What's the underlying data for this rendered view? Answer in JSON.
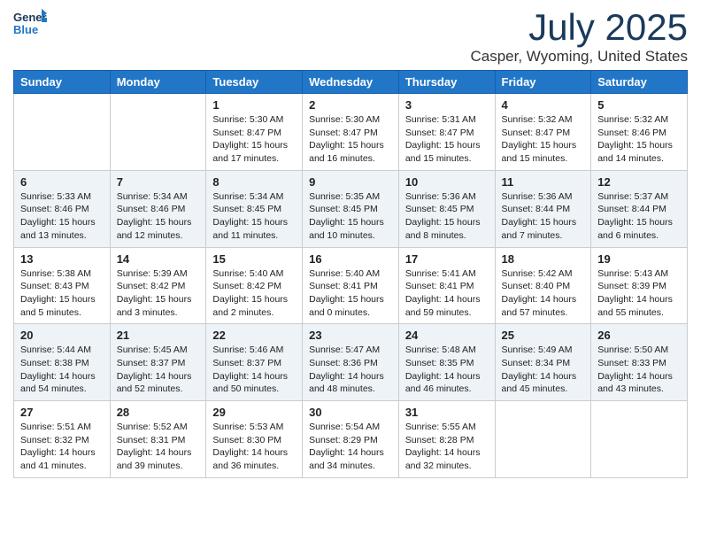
{
  "header": {
    "logo_line1": "General",
    "logo_line2": "Blue",
    "main_title": "July 2025",
    "subtitle": "Casper, Wyoming, United States"
  },
  "calendar": {
    "days_of_week": [
      "Sunday",
      "Monday",
      "Tuesday",
      "Wednesday",
      "Thursday",
      "Friday",
      "Saturday"
    ],
    "weeks": [
      [
        {
          "day": "",
          "info": ""
        },
        {
          "day": "",
          "info": ""
        },
        {
          "day": "1",
          "info": "Sunrise: 5:30 AM\nSunset: 8:47 PM\nDaylight: 15 hours\nand 17 minutes."
        },
        {
          "day": "2",
          "info": "Sunrise: 5:30 AM\nSunset: 8:47 PM\nDaylight: 15 hours\nand 16 minutes."
        },
        {
          "day": "3",
          "info": "Sunrise: 5:31 AM\nSunset: 8:47 PM\nDaylight: 15 hours\nand 15 minutes."
        },
        {
          "day": "4",
          "info": "Sunrise: 5:32 AM\nSunset: 8:47 PM\nDaylight: 15 hours\nand 15 minutes."
        },
        {
          "day": "5",
          "info": "Sunrise: 5:32 AM\nSunset: 8:46 PM\nDaylight: 15 hours\nand 14 minutes."
        }
      ],
      [
        {
          "day": "6",
          "info": "Sunrise: 5:33 AM\nSunset: 8:46 PM\nDaylight: 15 hours\nand 13 minutes."
        },
        {
          "day": "7",
          "info": "Sunrise: 5:34 AM\nSunset: 8:46 PM\nDaylight: 15 hours\nand 12 minutes."
        },
        {
          "day": "8",
          "info": "Sunrise: 5:34 AM\nSunset: 8:45 PM\nDaylight: 15 hours\nand 11 minutes."
        },
        {
          "day": "9",
          "info": "Sunrise: 5:35 AM\nSunset: 8:45 PM\nDaylight: 15 hours\nand 10 minutes."
        },
        {
          "day": "10",
          "info": "Sunrise: 5:36 AM\nSunset: 8:45 PM\nDaylight: 15 hours\nand 8 minutes."
        },
        {
          "day": "11",
          "info": "Sunrise: 5:36 AM\nSunset: 8:44 PM\nDaylight: 15 hours\nand 7 minutes."
        },
        {
          "day": "12",
          "info": "Sunrise: 5:37 AM\nSunset: 8:44 PM\nDaylight: 15 hours\nand 6 minutes."
        }
      ],
      [
        {
          "day": "13",
          "info": "Sunrise: 5:38 AM\nSunset: 8:43 PM\nDaylight: 15 hours\nand 5 minutes."
        },
        {
          "day": "14",
          "info": "Sunrise: 5:39 AM\nSunset: 8:42 PM\nDaylight: 15 hours\nand 3 minutes."
        },
        {
          "day": "15",
          "info": "Sunrise: 5:40 AM\nSunset: 8:42 PM\nDaylight: 15 hours\nand 2 minutes."
        },
        {
          "day": "16",
          "info": "Sunrise: 5:40 AM\nSunset: 8:41 PM\nDaylight: 15 hours\nand 0 minutes."
        },
        {
          "day": "17",
          "info": "Sunrise: 5:41 AM\nSunset: 8:41 PM\nDaylight: 14 hours\nand 59 minutes."
        },
        {
          "day": "18",
          "info": "Sunrise: 5:42 AM\nSunset: 8:40 PM\nDaylight: 14 hours\nand 57 minutes."
        },
        {
          "day": "19",
          "info": "Sunrise: 5:43 AM\nSunset: 8:39 PM\nDaylight: 14 hours\nand 55 minutes."
        }
      ],
      [
        {
          "day": "20",
          "info": "Sunrise: 5:44 AM\nSunset: 8:38 PM\nDaylight: 14 hours\nand 54 minutes."
        },
        {
          "day": "21",
          "info": "Sunrise: 5:45 AM\nSunset: 8:37 PM\nDaylight: 14 hours\nand 52 minutes."
        },
        {
          "day": "22",
          "info": "Sunrise: 5:46 AM\nSunset: 8:37 PM\nDaylight: 14 hours\nand 50 minutes."
        },
        {
          "day": "23",
          "info": "Sunrise: 5:47 AM\nSunset: 8:36 PM\nDaylight: 14 hours\nand 48 minutes."
        },
        {
          "day": "24",
          "info": "Sunrise: 5:48 AM\nSunset: 8:35 PM\nDaylight: 14 hours\nand 46 minutes."
        },
        {
          "day": "25",
          "info": "Sunrise: 5:49 AM\nSunset: 8:34 PM\nDaylight: 14 hours\nand 45 minutes."
        },
        {
          "day": "26",
          "info": "Sunrise: 5:50 AM\nSunset: 8:33 PM\nDaylight: 14 hours\nand 43 minutes."
        }
      ],
      [
        {
          "day": "27",
          "info": "Sunrise: 5:51 AM\nSunset: 8:32 PM\nDaylight: 14 hours\nand 41 minutes."
        },
        {
          "day": "28",
          "info": "Sunrise: 5:52 AM\nSunset: 8:31 PM\nDaylight: 14 hours\nand 39 minutes."
        },
        {
          "day": "29",
          "info": "Sunrise: 5:53 AM\nSunset: 8:30 PM\nDaylight: 14 hours\nand 36 minutes."
        },
        {
          "day": "30",
          "info": "Sunrise: 5:54 AM\nSunset: 8:29 PM\nDaylight: 14 hours\nand 34 minutes."
        },
        {
          "day": "31",
          "info": "Sunrise: 5:55 AM\nSunset: 8:28 PM\nDaylight: 14 hours\nand 32 minutes."
        },
        {
          "day": "",
          "info": ""
        },
        {
          "day": "",
          "info": ""
        }
      ]
    ]
  }
}
